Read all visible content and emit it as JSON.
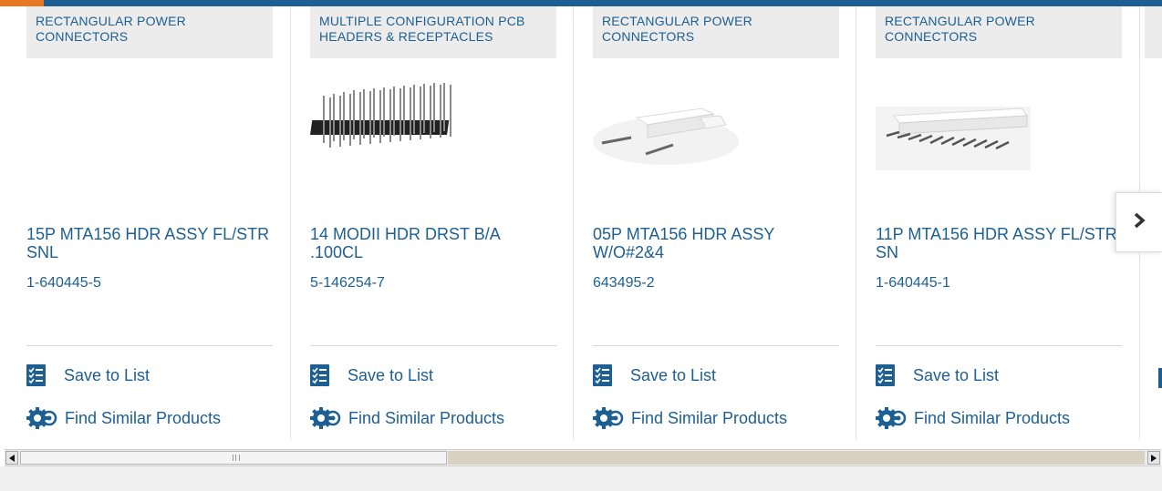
{
  "cards": [
    {
      "category": "RECTANGULAR POWER CONNECTORS",
      "title": "15P MTA156 HDR ASSY FL/STR SNL",
      "part_number": "1-640445-5",
      "save_label": "Save to List",
      "similar_label": "Find Similar Products",
      "image": "none"
    },
    {
      "category": "MULTIPLE CONFIGURATION PCB HEADERS & RECEPTACLES",
      "title": "14 MODII HDR DRST B/A .100CL",
      "part_number": "5-146254-7",
      "save_label": "Save to List",
      "similar_label": "Find Similar Products",
      "image": "pin-header"
    },
    {
      "category": "RECTANGULAR POWER CONNECTORS",
      "title": "05P MTA156 HDR ASSY W/O#2&4",
      "part_number": "643495-2",
      "save_label": "Save to List",
      "similar_label": "Find Similar Products",
      "image": "white-header-small"
    },
    {
      "category": "RECTANGULAR POWER CONNECTORS",
      "title": "11P MTA156 HDR ASSY FL/STR SN",
      "part_number": "1-640445-1",
      "save_label": "Save to List",
      "similar_label": "Find Similar Products",
      "image": "white-header-long"
    }
  ],
  "colors": {
    "brand_blue": "#1d5f93",
    "accent_orange": "#e87722",
    "category_bg": "#ececec"
  },
  "icons": {
    "save": "checklist-icon",
    "similar": "gears-icon",
    "next": "chevron-right-icon"
  }
}
